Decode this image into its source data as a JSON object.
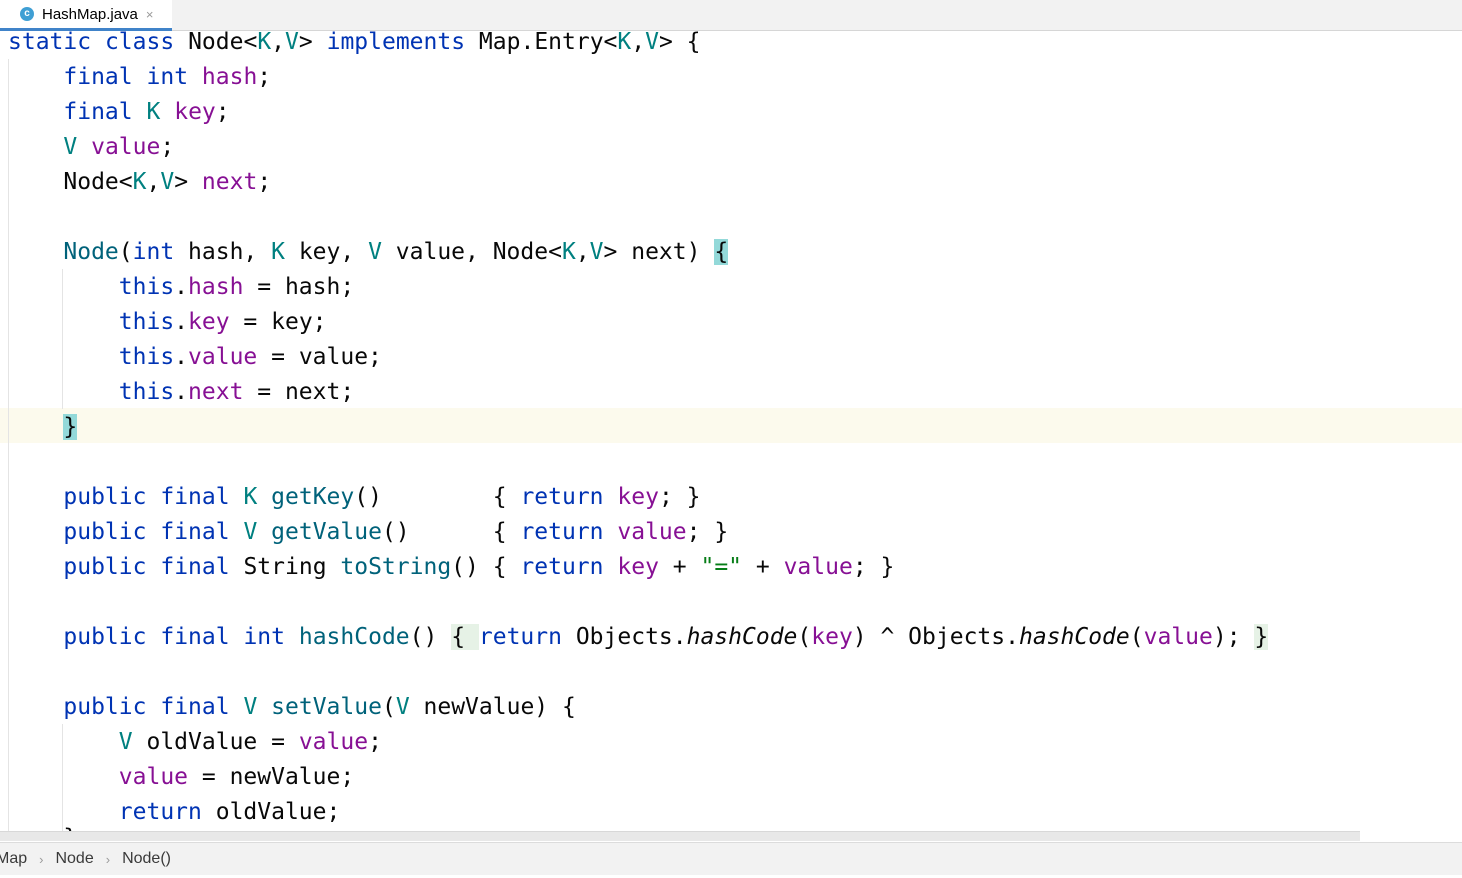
{
  "tab": {
    "file_name": "HashMap.java",
    "icon_letter": "c",
    "close_glyph": "×"
  },
  "code": {
    "l1": {
      "a": "static",
      "b": "class",
      "c": "Node<",
      "d": "K",
      "e": ",",
      "f": "V",
      "g": "> ",
      "h": "implements",
      "i": " Map.Entry<",
      "j": "K",
      "k": ",",
      "l": "V",
      "m": "> {"
    },
    "l2": {
      "a": "final",
      "b": "int",
      "c": "hash",
      "d": ";"
    },
    "l3": {
      "a": "final",
      "b": "K",
      "c": "key",
      "d": ";"
    },
    "l4": {
      "a": "V",
      "b": "value",
      "c": ";"
    },
    "l5": {
      "a": "Node<",
      "b": "K",
      "c": ",",
      "d": "V",
      "e": "> ",
      "f": "next",
      "g": ";"
    },
    "l7": {
      "a": "Node",
      "b": "(",
      "c": "int",
      "d": " hash, ",
      "e": "K",
      "f": " key, ",
      "g": "V",
      "h": " value, Node<",
      "i": "K",
      "j": ",",
      "k": "V",
      "l": "> next) ",
      "m": "{"
    },
    "l8": {
      "a": "this",
      "b": ".",
      "c": "hash",
      "d": " = hash;"
    },
    "l9": {
      "a": "this",
      "b": ".",
      "c": "key",
      "d": " = key;"
    },
    "l10": {
      "a": "this",
      "b": ".",
      "c": "value",
      "d": " = value;"
    },
    "l11": {
      "a": "this",
      "b": ".",
      "c": "next",
      "d": " = next;"
    },
    "l12": {
      "a": "}"
    },
    "l14": {
      "a": "public",
      "b": "final",
      "c": "K",
      "d": "getKey",
      "e": "()        { ",
      "f": "return",
      "g": "key",
      "h": "; }"
    },
    "l15": {
      "a": "public",
      "b": "final",
      "c": "V",
      "d": "getValue",
      "e": "()      { ",
      "f": "return",
      "g": "value",
      "h": "; }"
    },
    "l16": {
      "a": "public",
      "b": "final",
      "c": "String ",
      "d": "toString",
      "e": "() { ",
      "f": "return",
      "g": "key",
      "h": " + ",
      "i": "\"=\"",
      "j": " + ",
      "k": "value",
      "l": "; }"
    },
    "l18": {
      "a": "public",
      "b": "final",
      "c": "int",
      "d": "hashCode",
      "e": "() ",
      "f": "{ ",
      "g": "return",
      "h": " Objects.",
      "i": "hashCode",
      "j": "(",
      "k": "key",
      "l": ") ^ Objects.",
      "m": "hashCode",
      "n": "(",
      "o": "value",
      "p": "); ",
      "q": "}"
    },
    "l20": {
      "a": "public",
      "b": "final",
      "c": "V",
      "d": "setValue",
      "e": "(",
      "f": "V",
      "g": " newValue) {"
    },
    "l21": {
      "a": "V",
      "b": " oldValue = ",
      "c": "value",
      "d": ";"
    },
    "l22": {
      "a": "value",
      "b": " = newValue;"
    },
    "l23": {
      "a": "return",
      "b": " oldValue;"
    },
    "l24": {
      "a": "}"
    }
  },
  "breadcrumbs": {
    "items": [
      "Map",
      "Node",
      "Node()"
    ],
    "separator": "›"
  },
  "colors": {
    "keyword": "#0033b3",
    "type_param": "#008080",
    "field": "#871094",
    "method": "#00627a",
    "string": "#067d17",
    "caret_row": "#fcfaed",
    "brace_match": "#93d9d9"
  }
}
